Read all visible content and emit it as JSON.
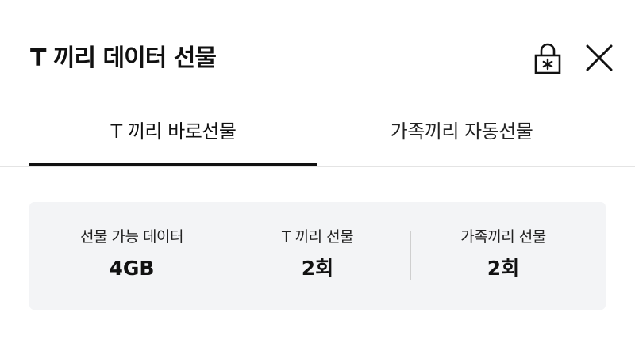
{
  "header": {
    "title": "T 끼리 데이터 선물",
    "lock_icon": "lock-asterisk-icon",
    "close_icon": "close-icon"
  },
  "tabs": [
    {
      "label": "T 끼리 바로선물",
      "selected": true
    },
    {
      "label": "가족끼리 자동선물",
      "selected": false
    }
  ],
  "summary": {
    "items": [
      {
        "label": "선물 가능 데이터",
        "value": "4GB"
      },
      {
        "label": "T 끼리 선물",
        "value": "2회"
      },
      {
        "label": "가족끼리 선물",
        "value": "2회"
      }
    ]
  },
  "colors": {
    "text": "#111111",
    "panel_bg": "#f3f4f6",
    "tab_indicator": "#111111",
    "divider": "#cfcfcf"
  }
}
